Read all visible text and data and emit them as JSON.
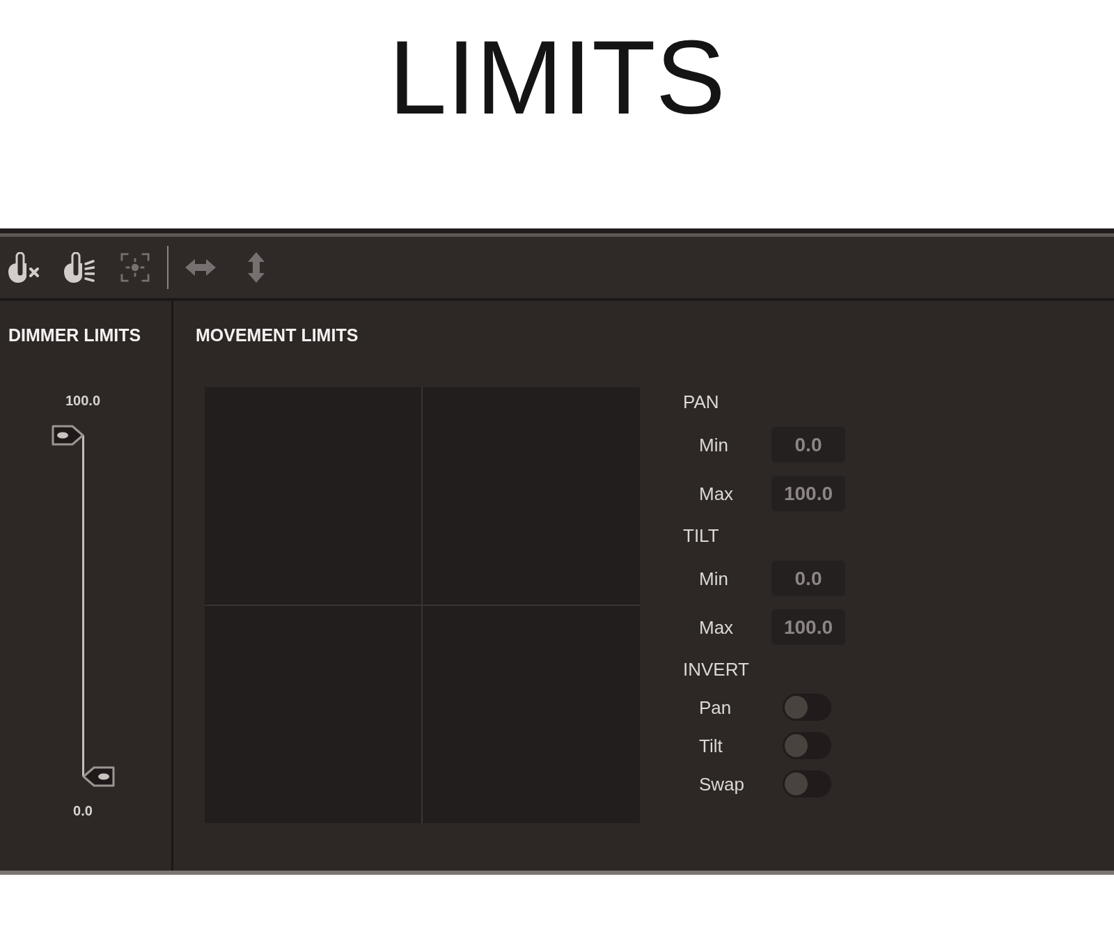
{
  "title": "LIMITS",
  "toolbar": {
    "groups": [
      {
        "buttons": [
          {
            "kind": "clear",
            "disabled": false
          },
          {
            "kind": "beam",
            "disabled": false
          },
          {
            "kind": "center",
            "disabled": true
          }
        ]
      },
      {
        "buttons": [
          {
            "kind": "horizontal",
            "disabled": true
          },
          {
            "kind": "vertical",
            "disabled": true
          }
        ]
      }
    ]
  },
  "dimmer_limits": {
    "title": "DIMMER LIMITS",
    "max": {
      "reading": "100.0",
      "level": 1
    },
    "min": {
      "reading": "0.0",
      "level": 0
    }
  },
  "movement_limits": {
    "title": "MOVEMENT LIMITS",
    "pan": {
      "label": "PAN",
      "fields": [
        {
          "label": "Min",
          "value": "0.0"
        },
        {
          "label": "Max",
          "value": "100.0"
        }
      ]
    },
    "tilt": {
      "label": "TILT",
      "fields": [
        {
          "label": "Min",
          "value": "0.0"
        },
        {
          "label": "Max",
          "value": "100.0"
        }
      ]
    },
    "invert": {
      "label": "INVERT",
      "toggles": [
        {
          "label": "Pan",
          "on": false
        },
        {
          "label": "Tilt",
          "on": false
        },
        {
          "label": "Swap",
          "on": false
        }
      ]
    }
  }
}
